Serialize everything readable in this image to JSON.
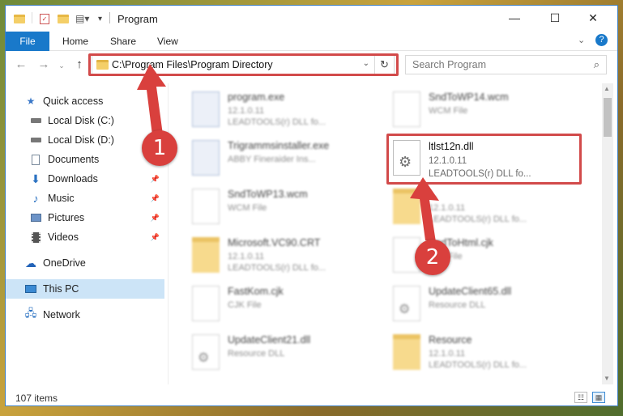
{
  "window": {
    "title": "Program",
    "controls": {
      "minimize": "—",
      "maximize": "☐",
      "close": "✕"
    }
  },
  "ribbon": {
    "tabs": [
      "File",
      "Home",
      "Share",
      "View"
    ],
    "help": "?"
  },
  "navigation": {
    "back": "←",
    "forward": "→",
    "up": "↑",
    "address": "C:\\Program Files\\Program Directory",
    "refresh": "↻",
    "search_placeholder": "Search Program"
  },
  "sidebar": {
    "items": [
      {
        "label": "Quick access",
        "icon": "star-icon",
        "pinned": false
      },
      {
        "label": "Local Disk (C:)",
        "icon": "drive-icon",
        "pinned": false
      },
      {
        "label": "Local Disk (D:)",
        "icon": "drive-icon",
        "pinned": false
      },
      {
        "label": "Documents",
        "icon": "documents-icon",
        "pinned": false
      },
      {
        "label": "Downloads",
        "icon": "download-icon",
        "pinned": true
      },
      {
        "label": "Music",
        "icon": "music-icon",
        "pinned": true
      },
      {
        "label": "Pictures",
        "icon": "pictures-icon",
        "pinned": true
      },
      {
        "label": "Videos",
        "icon": "videos-icon",
        "pinned": true
      },
      {
        "label": "OneDrive",
        "icon": "cloud-icon",
        "pinned": false
      },
      {
        "label": "This PC",
        "icon": "computer-icon",
        "pinned": false,
        "selected": true
      },
      {
        "label": "Network",
        "icon": "network-icon",
        "pinned": false
      }
    ]
  },
  "files": [
    {
      "name": "program.exe",
      "line2": "12.1.0.11",
      "line3": "LEADTOOLS(r) DLL fo...",
      "icon": "exe"
    },
    {
      "name": "SndToWP14.wcm",
      "line2": "WCM File",
      "line3": "",
      "icon": "doc"
    },
    {
      "name": "Trigrammsinstaller.exe",
      "line2": "ABBY Fineraider Ins...",
      "line3": "",
      "icon": "exe"
    },
    {
      "name": "SndToWP13.wcm",
      "line2": "WCM File",
      "line3": "",
      "icon": "doc"
    },
    {
      "name": "...",
      "line2": "12.1.0.11",
      "line3": "LEADTOOLS(r) DLL fo...",
      "icon": "folder"
    },
    {
      "name": "Microsoft.VC90.CRT",
      "line2": "12.1.0.11",
      "line3": "LEADTOOLS(r) DLL fo...",
      "icon": "folder"
    },
    {
      "name": "SndToHtml.cjk",
      "line2": "CJK File",
      "line3": "",
      "icon": "doc"
    },
    {
      "name": "FastKom.cjk",
      "line2": "CJK File",
      "line3": "",
      "icon": "doc"
    },
    {
      "name": "UpdateClient65.dll",
      "line2": "Resource DLL",
      "line3": "",
      "icon": "gear"
    },
    {
      "name": "UpdateClient21.dll",
      "line2": "Resource DLL",
      "line3": "",
      "icon": "gear"
    },
    {
      "name": "Resource",
      "line2": "12.1.0.11",
      "line3": "LEADTOOLS(r) DLL fo...",
      "icon": "folder"
    }
  ],
  "focus_file": {
    "name": "ltlst12n.dll",
    "version": "12.1.0.11",
    "description": "LEADTOOLS(r) DLL fo..."
  },
  "annotations": {
    "step1": "1",
    "step2": "2"
  },
  "status": {
    "count": "107 items"
  },
  "colors": {
    "accent": "#1979ca",
    "highlight": "#d24a4a",
    "selection": "#cce4f7"
  }
}
